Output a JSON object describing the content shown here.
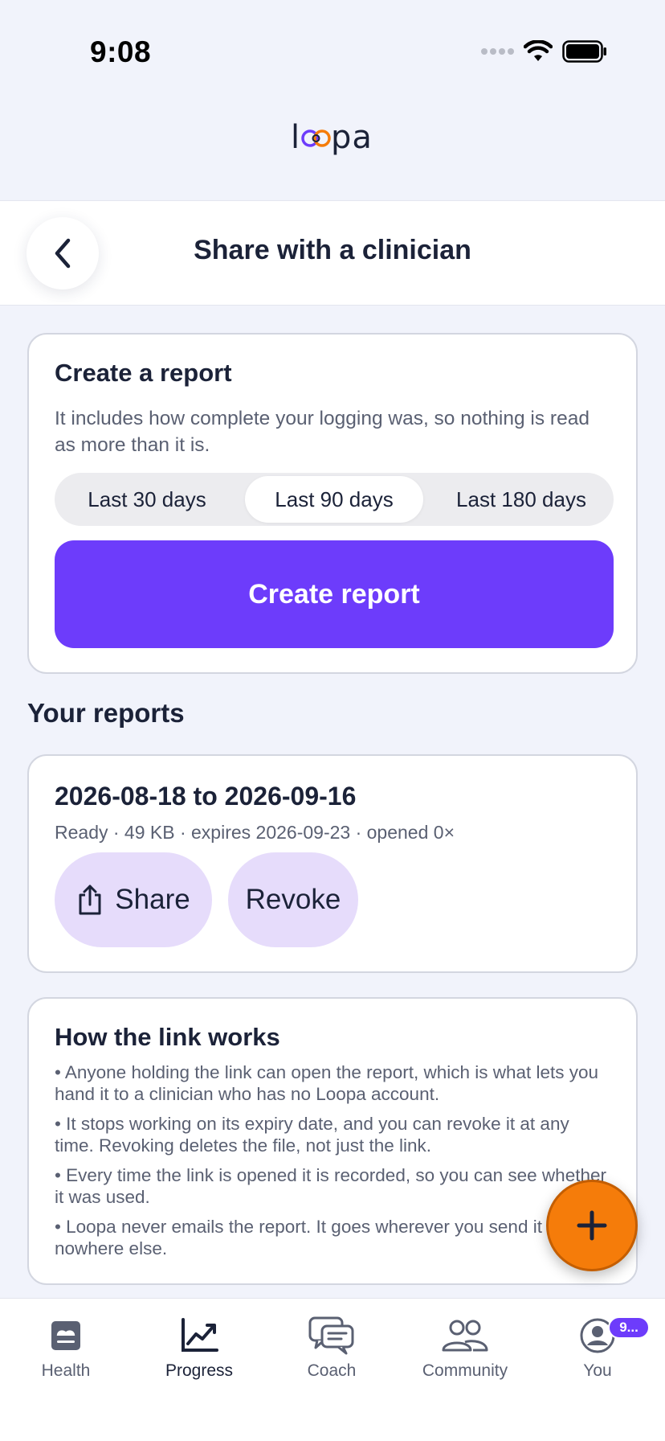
{
  "status": {
    "time": "9:08"
  },
  "brand": {
    "name": "loopa"
  },
  "header": {
    "title": "Share with a clinician"
  },
  "create_report": {
    "title": "Create a report",
    "subtitle": "It includes how complete your logging was, so nothing is read as more than it is.",
    "ranges": [
      {
        "label": "Last 30 days",
        "selected": false
      },
      {
        "label": "Last 90 days",
        "selected": true
      },
      {
        "label": "Last 180 days",
        "selected": false
      }
    ],
    "button_label": "Create report"
  },
  "reports_section": {
    "title": "Your reports"
  },
  "reports": [
    {
      "range": "2026-08-18 to 2026-09-16",
      "meta": "Ready · 49 KB · expires 2026-09-23 · opened 0×",
      "share_label": "Share",
      "revoke_label": "Revoke"
    }
  ],
  "how_it_works": {
    "title": "How the link works",
    "items": [
      "• Anyone holding the link can open the report, which is what lets you hand it to a clinician who has no Loopa account.",
      "• It stops working on its expiry date, and you can revoke it at any time. Revoking deletes the file, not just the link.",
      "• Every time the link is opened it is recorded, so you can see whether it was used.",
      "• Loopa never emails the report. It goes wherever you send it and nowhere else."
    ]
  },
  "fab": {
    "icon": "plus-icon"
  },
  "tabs": [
    {
      "label": "Health",
      "icon": "health-card-icon",
      "active": false
    },
    {
      "label": "Progress",
      "icon": "chart-trend-icon",
      "active": true
    },
    {
      "label": "Coach",
      "icon": "chat-bubbles-icon",
      "active": false
    },
    {
      "label": "Community",
      "icon": "people-icon",
      "active": false
    },
    {
      "label": "You",
      "icon": "profile-icon",
      "active": false,
      "badge": "9..."
    }
  ],
  "colors": {
    "accent": "#6d3cfb",
    "fab": "#f57c0a",
    "pill": "#e6dcfb",
    "background": "#f1f3fb"
  }
}
